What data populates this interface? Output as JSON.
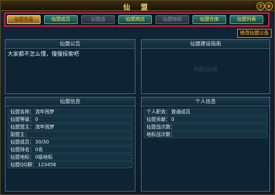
{
  "window": {
    "title": "仙 盟",
    "help_label": "?",
    "close_label": "x"
  },
  "tabs": [
    {
      "label": "仙盟信息",
      "state": "active"
    },
    {
      "label": "仙盟成员",
      "state": "normal"
    },
    {
      "label": "仙盟战",
      "state": "disabled"
    },
    {
      "label": "仙盟商店",
      "state": "normal"
    },
    {
      "label": "仙盟地标",
      "state": "disabled"
    },
    {
      "label": "仙盟仓库",
      "state": "normal"
    },
    {
      "label": "仙盟列表",
      "state": "normal"
    }
  ],
  "edit_notice_label": "修改仙盟公告",
  "notice": {
    "title": "仙盟公告",
    "text": "大家都不怎么懂，慢慢探索吧"
  },
  "guide": {
    "title": "仙盟建设指南",
    "watermark": "需建设仙盟"
  },
  "guild_info": {
    "title": "仙盟信息",
    "rows": [
      {
        "label": "仙盟名称：",
        "value": "流年残梦"
      },
      {
        "label": "仙盟等级：",
        "value": "0"
      },
      {
        "label": "仙盟盟主：",
        "value": "流年残梦"
      },
      {
        "label": "副盟主：",
        "value": ""
      },
      {
        "label": "仙盟成员：",
        "value": "30/30"
      },
      {
        "label": "仙盟排名：",
        "value": "0名"
      },
      {
        "label": "仙盟地标：",
        "value": "0级地标"
      },
      {
        "label": "仙盟QQ群：",
        "value": "123456"
      }
    ]
  },
  "personal_info": {
    "title": "个人信息",
    "rows": [
      {
        "label": "个人职务：",
        "value": "普通成员"
      },
      {
        "label": "仙盟贡献：",
        "value": "0"
      },
      {
        "label": "仙盟战次数：",
        "value": ""
      },
      {
        "label": "地标战次数：",
        "value": ""
      }
    ]
  },
  "colors": {
    "active_tab": "#d9a640",
    "tab": "#2e7a70",
    "highlight_border": "#d0203c",
    "title_gold": "#f4d36a"
  }
}
